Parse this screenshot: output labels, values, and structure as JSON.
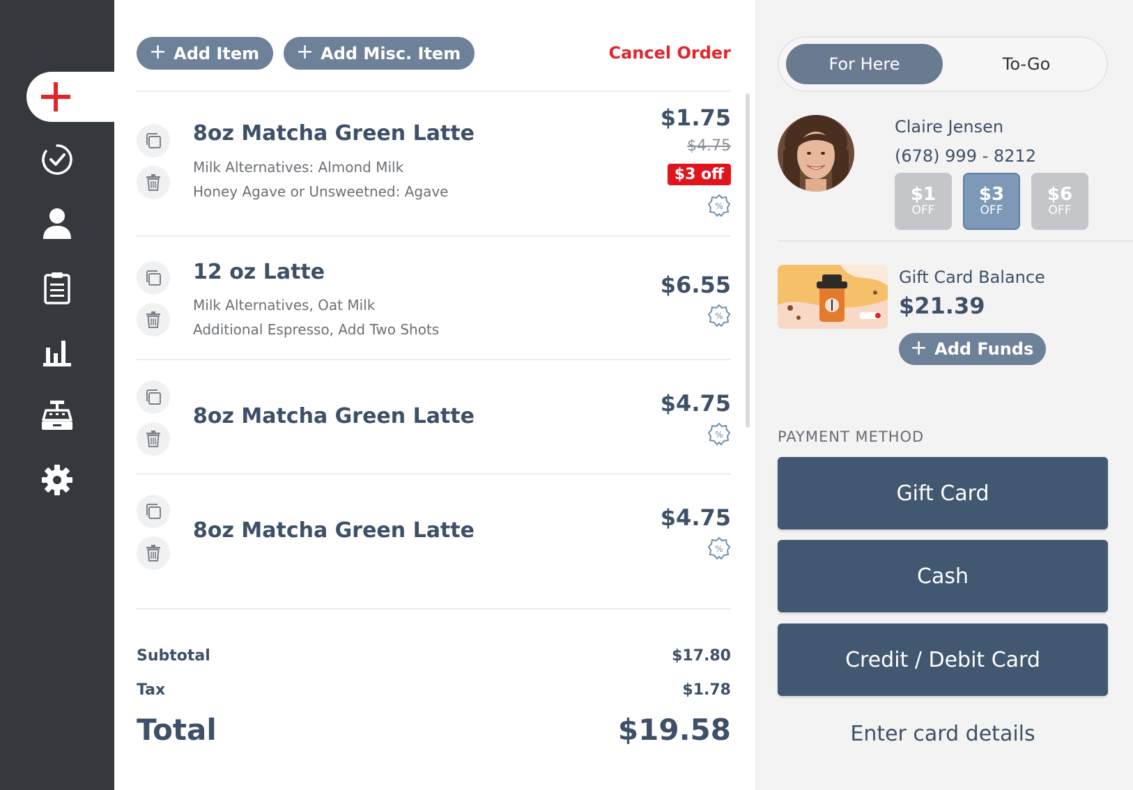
{
  "toolbar": {
    "add_item_label": "Add Item",
    "add_misc_label": "Add Misc. Item",
    "cancel_label": "Cancel Order"
  },
  "nav": {
    "items": [
      "new-order",
      "orders-completed",
      "customers",
      "clipboard",
      "reports",
      "register",
      "settings"
    ]
  },
  "order_items": [
    {
      "name": "8oz Matcha Green Latte",
      "modifiers": [
        "Milk Alternatives: Almond Milk",
        "Honey Agave or Unsweetned: Agave"
      ],
      "price": "$1.75",
      "original_price": "$4.75",
      "discount_tag": "$3 off"
    },
    {
      "name": "12 oz Latte",
      "modifiers": [
        "Milk Alternatives, Oat Milk",
        "Additional Espresso, Add Two Shots"
      ],
      "price": "$6.55"
    },
    {
      "name": "8oz Matcha Green Latte",
      "modifiers": [],
      "price": "$4.75"
    },
    {
      "name": "8oz Matcha Green Latte",
      "modifiers": [],
      "price": "$4.75"
    }
  ],
  "summary": {
    "subtotal_label": "Subtotal",
    "subtotal": "$17.80",
    "tax_label": "Tax",
    "tax": "$1.78",
    "total_label": "Total",
    "total": "$19.58"
  },
  "service_mode": {
    "options": [
      "For Here",
      "To-Go"
    ],
    "selected": "For Here"
  },
  "customer": {
    "name": "Claire Jensen",
    "phone": "(678) 999 - 8212",
    "coupons": [
      {
        "amount": "$1",
        "label": "OFF",
        "selected": false
      },
      {
        "amount": "$3",
        "label": "OFF",
        "selected": true
      },
      {
        "amount": "$6",
        "label": "OFF",
        "selected": false
      }
    ]
  },
  "gift_card": {
    "label": "Gift Card Balance",
    "balance": "$21.39",
    "add_funds_label": "Add Funds"
  },
  "payment": {
    "heading": "PAYMENT METHOD",
    "methods": [
      "Gift Card",
      "Cash",
      "Credit / Debit Card"
    ],
    "enter_card_label": "Enter card details"
  },
  "colors": {
    "sidebar": "#35383d",
    "accent_red": "#e0262b",
    "slate_button": "#6d8199",
    "payment_button": "#425770",
    "text": "#3d5068"
  }
}
